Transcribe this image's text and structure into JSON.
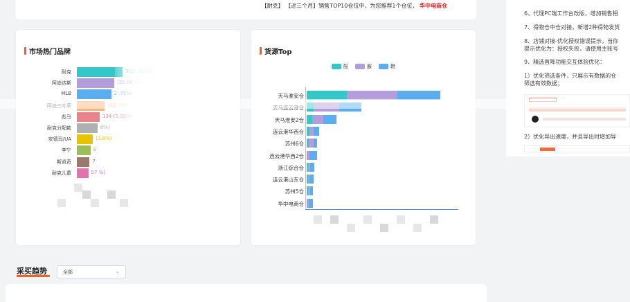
{
  "top_notice": {
    "brand_tag": "【耐克】",
    "text": "【近三个月】销售TOP10仓位中，为您推荐1个仓位，",
    "highlight": "华中电商仓"
  },
  "brand_card": {
    "title": "市场热门品牌",
    "rows": [
      {
        "label": "耐克",
        "value_text": "3(25.51%)",
        "color": "#33c7c7",
        "fraction": 1.0
      },
      {
        "label": "阿迪达斯",
        "value_text": "(20.66%)",
        "color": "#b39ddb",
        "fraction": 0.82
      },
      {
        "label": "MLB",
        "value_text": "3 .79%)",
        "color": "#5aaef0",
        "fraction": 0.75
      },
      {
        "label": "阿迪三叶草",
        "value_text": "162 3%)",
        "color": "#ffb27a",
        "fraction": 0.6
      },
      {
        "label": "彪马",
        "value_text": "134 (5.35%)",
        "color": "#e8858a",
        "fraction": 0.5
      },
      {
        "label": "耐克分配款",
        "value_text": "8%)",
        "color": "#b0b0b0",
        "fraction": 0.45
      },
      {
        "label": "安德玛/UA",
        "value_text": "(3.8%)",
        "color": "#e6c400",
        "fraction": 0.35
      },
      {
        "label": "李宁",
        "value_text": "8",
        "color": "#9cbf5a",
        "fraction": 0.3
      },
      {
        "label": "斯凯奇",
        "value_text": "7",
        "color": "#9b7a6b",
        "fraction": 0.28
      },
      {
        "label": "耐克儿童",
        "value_text": "57 %)",
        "color": "#e571b1",
        "fraction": 0.25
      }
    ]
  },
  "warehouse_card": {
    "title": "货源Top",
    "legend": [
      {
        "label": "配",
        "color": "#33c7c7"
      },
      {
        "label": "服",
        "color": "#b39ddb"
      },
      {
        "label": "鞋",
        "color": "#5aaef0"
      }
    ],
    "rows": [
      {
        "label": "天马淮安仓",
        "segments": [
          58,
          73,
          62
        ]
      },
      {
        "label": "天马连云港仓",
        "segments": [
          10,
          37,
          32
        ]
      },
      {
        "label": "天马淮安2仓",
        "segments": [
          8,
          16,
          19
        ]
      },
      {
        "label": "连云港华西仓",
        "segments": [
          4,
          6,
          8
        ]
      },
      {
        "label": "苏州6仓",
        "segments": [
          3,
          7,
          5
        ]
      },
      {
        "label": "连云港华西2仓",
        "segments": [
          1,
          3,
          11
        ]
      },
      {
        "label": "浙江综合仓",
        "segments": [
          2,
          3,
          6
        ]
      },
      {
        "label": "连云港山东仓",
        "segments": [
          2,
          2,
          6
        ]
      },
      {
        "label": "苏州5仓",
        "segments": [
          2,
          3,
          4
        ]
      },
      {
        "label": "华中电商仓",
        "segments": [
          1,
          2,
          6
        ]
      }
    ]
  },
  "trend": {
    "title": "采买趋势",
    "select_value": "全部"
  },
  "right_panel": {
    "lines": [
      "6、代理PC端工作台改版，增加销售相",
      "7、得物仓中仓对接，新增2种得物发货",
      "8、店铺对接-优化授权错误提示，当你",
      "提示优化为：授权失败，请使用主账号",
      "9、精选直降功能交互体验优化：",
      "1）优化筛选条件，只展示有数据的仓",
      "筛选有效数据；",
      "2）优化导出速度，并且导出时增加导"
    ]
  }
}
